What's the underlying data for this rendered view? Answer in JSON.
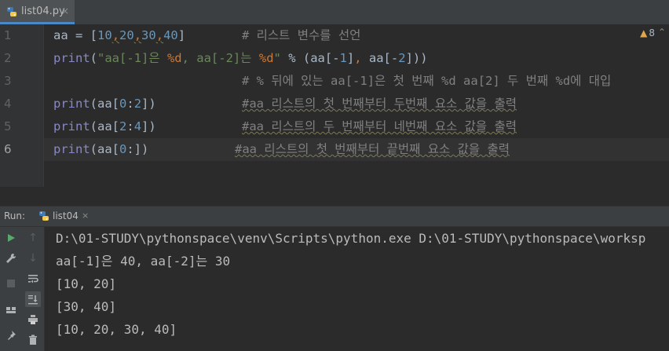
{
  "tab": {
    "filename": "list04.py",
    "close": "×"
  },
  "inspection": {
    "warning_count": "8"
  },
  "gutter": [
    "1",
    "2",
    "3",
    "4",
    "5",
    "6"
  ],
  "code": {
    "line1": {
      "var": "aa",
      "op": " = ",
      "lb": "[",
      "n1": "10",
      "c1": ",",
      "n2": "20",
      "c2": ",",
      "n3": "30",
      "c3": ",",
      "n4": "40",
      "rb": "]",
      "comment": "# 리스트 변수를 선언"
    },
    "line2": {
      "fn": "print",
      "lp": "(",
      "s1": "\"aa[-1]은 ",
      "f1": "%d",
      "s2": ", aa[-2]는 ",
      "f2": "%d",
      "s3": "\"",
      "rest1": " % (aa[-",
      "n1": "1",
      "rest2": "]",
      "comma": ",",
      "rest3": " aa[-",
      "n2": "2",
      "rest4": "]))"
    },
    "line3": {
      "comment": "# % 뒤에 있는 aa[-1]은 첫 번째 %d aa[2] 두 번째 %d에 대입"
    },
    "line4": {
      "fn": "print",
      "args_a": "(aa[",
      "n1": "0",
      "colon": ":",
      "n2": "2",
      "args_b": "])",
      "comment": "#aa 리스트의 첫 번째부터 두번째 요소 값을 출력"
    },
    "line5": {
      "fn": "print",
      "args_a": "(aa[",
      "n1": "2",
      "colon": ":",
      "n2": "4",
      "args_b": "])",
      "comment": "#aa 리스트의 두 번째부터 네번째 요소 값을 출력"
    },
    "line6": {
      "fn": "print",
      "args_a": "(aa[",
      "n1": "0",
      "args_b": ":])",
      "comment": "#aa 리스트의 첫 번째부터 끝번째 요소 값을 출력"
    }
  },
  "run": {
    "label": "Run:",
    "tab_name": "list04",
    "close": "×",
    "output": [
      "D:\\01-STUDY\\pythonspace\\venv\\Scripts\\python.exe D:\\01-STUDY\\pythonspace\\worksp",
      "aa[-1]은 40, aa[-2]는 30",
      "[10, 20]",
      "[30, 40]",
      "[10, 20, 30, 40]"
    ]
  },
  "colors": {
    "accent": "#4a88c7",
    "run_green": "#59a869",
    "warning": "#e0a74e"
  }
}
